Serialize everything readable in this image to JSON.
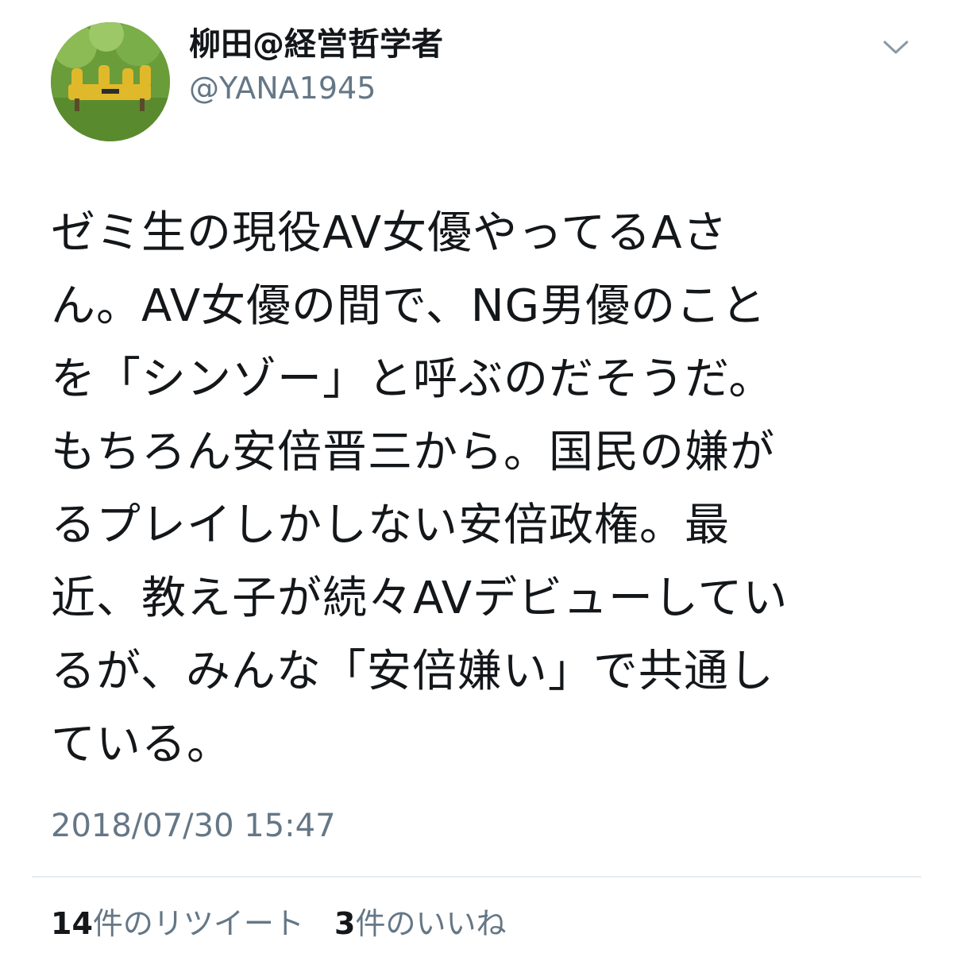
{
  "tweet": {
    "author": {
      "display_name": "柳田@経営哲学者",
      "handle": "@YANA1945"
    },
    "lines": [
      "ゼミ生の現役AV女優やってるAさ",
      "ん。AV女優の間で、NG男優のこと",
      "を「シンゾー」と呼ぶのだそうだ。",
      "もちろん安倍晋三から。国民の嫌が",
      "るプレイしかしない安倍政権。最",
      "近、教え子が続々AVデビューしてい",
      "るが、みんな「安倍嫌い」で共通し",
      "ている。"
    ],
    "timestamp": "2018/07/30 15:47",
    "stats": {
      "retweets_count": "14",
      "retweets_label": "件のリツイート",
      "likes_count": "3",
      "likes_label": "件のいいね"
    }
  },
  "icons": {
    "menu": "chevron-down-icon"
  },
  "colors": {
    "text": "#14171a",
    "secondary": "#657786",
    "divider": "#e6ecf0"
  }
}
